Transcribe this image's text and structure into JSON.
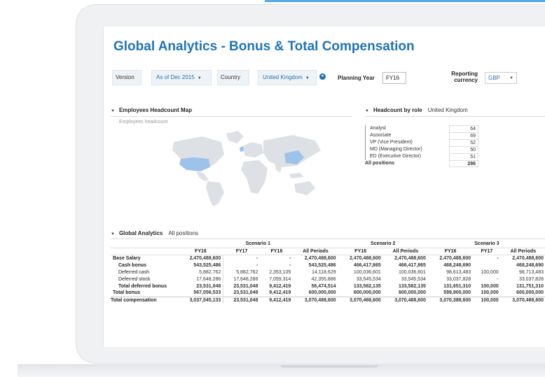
{
  "title": "Global Analytics - Bonus & Total Compensation",
  "filters": {
    "version_label": "Version",
    "version_value": "As of Dec 2015",
    "country_label": "Country",
    "country_value": "United Kingdom",
    "planning_year_label": "Planning Year",
    "planning_year_value": "FY16",
    "reporting_currency_label_1": "Reporting",
    "reporting_currency_label_2": "currency",
    "reporting_currency_value": "GBP"
  },
  "headcount_map": {
    "title": "Employees Headcount Map",
    "subtitle": "Employees headcount"
  },
  "headcount_by_role": {
    "title": "Headcount by role",
    "country": "United Kingdom",
    "rows": [
      {
        "label": "Analyst",
        "value": "64"
      },
      {
        "label": "Associate",
        "value": "69"
      },
      {
        "label": "VP (Vice President)",
        "value": "52"
      },
      {
        "label": "MD (Managing Director)",
        "value": "50"
      },
      {
        "label": "ED (Executive Director)",
        "value": "51"
      }
    ],
    "total_label": "All positions",
    "total_value": "286"
  },
  "global_analytics": {
    "title": "Global Analytics",
    "filter": "All positions",
    "scenarios": [
      "Scenario 1",
      "Scenario 2",
      "Scenario 3"
    ],
    "columns": [
      "FY16",
      "FY17",
      "FY18",
      "All Periods",
      "FY16",
      "All Periods",
      "FY16",
      "FY17",
      "All Periods"
    ],
    "rows": [
      {
        "label": "Base Salary",
        "bold": true,
        "values": [
          "2,470,488,600",
          "-",
          "-",
          "2,470,488,600",
          "2,470,488,600",
          "2,470,488,600",
          "2,470,488,600",
          "-",
          "2,470,488,600"
        ]
      },
      {
        "label": "Cash bonus",
        "bold": true,
        "values": [
          "543,525,486",
          "-",
          "-",
          "543,525,486",
          "466,417,865",
          "466,417,865",
          "468,248,690",
          "",
          "468,248,690"
        ]
      },
      {
        "label": "Deferred cash",
        "bold": false,
        "values": [
          "5,882,762",
          "5,882,762",
          "2,353,105",
          "14,118,629",
          "100,036,601",
          "100,036,601",
          "98,613,483",
          "100,000",
          "98,713,483"
        ]
      },
      {
        "label": "Deferred stock",
        "bold": false,
        "values": [
          "17,648,286",
          "17,648,286",
          "7,059,314",
          "42,355,886",
          "33,545,534",
          "33,545,534",
          "33,037,828",
          "-",
          "33,037,828"
        ]
      },
      {
        "label": "Total deferred bonus",
        "bold": true,
        "values": [
          "23,531,048",
          "23,531,048",
          "9,412,419",
          "56,474,514",
          "133,582,135",
          "133,582,135",
          "131,651,310",
          "100,000",
          "131,751,310"
        ]
      },
      {
        "label": "Total bonus",
        "bold": true,
        "values": [
          "567,056,533",
          "23,531,048",
          "9,412,419",
          "600,000,000",
          "600,000,000",
          "600,000,000",
          "599,900,000",
          "100,000",
          "600,000,000"
        ]
      },
      {
        "label": "Total compensation",
        "bold": true,
        "values": [
          "3,037,545,133",
          "23,531,048",
          "9,412,419",
          "3,070,488,600",
          "3,070,488,600",
          "3,070,488,600",
          "3,070,388,600",
          "100,000",
          "3,070,488,600"
        ]
      }
    ]
  },
  "colors": {
    "accent": "#1e74b8",
    "map_land": "#dde1e6",
    "map_highlight": "#9ec3ea"
  }
}
